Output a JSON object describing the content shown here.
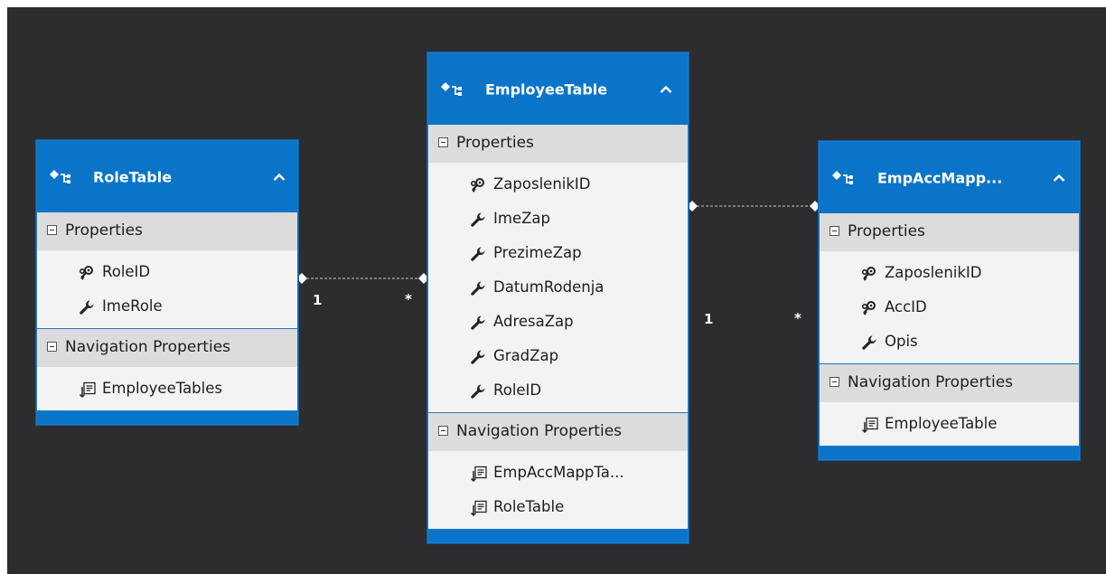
{
  "diagram": {
    "entities": [
      {
        "id": "role",
        "title": "RoleTable",
        "sections": [
          {
            "label": "Properties",
            "kind": "properties",
            "items": [
              {
                "label": "RoleID",
                "icon": "key-icon"
              },
              {
                "label": "ImeRole",
                "icon": "wrench-icon"
              }
            ]
          },
          {
            "label": "Navigation Properties",
            "kind": "navigation",
            "items": [
              {
                "label": "EmployeeTables",
                "icon": "navigation-property-icon"
              }
            ]
          }
        ]
      },
      {
        "id": "employee",
        "title": "EmployeeTable",
        "sections": [
          {
            "label": "Properties",
            "kind": "properties",
            "items": [
              {
                "label": "ZaposlenikID",
                "icon": "key-icon"
              },
              {
                "label": "ImeZap",
                "icon": "wrench-icon"
              },
              {
                "label": "PrezimeZap",
                "icon": "wrench-icon"
              },
              {
                "label": "DatumRodenja",
                "icon": "wrench-icon"
              },
              {
                "label": "AdresaZap",
                "icon": "wrench-icon"
              },
              {
                "label": "GradZap",
                "icon": "wrench-icon"
              },
              {
                "label": "RoleID",
                "icon": "wrench-icon"
              }
            ]
          },
          {
            "label": "Navigation Properties",
            "kind": "navigation",
            "items": [
              {
                "label": "EmpAccMappTa...",
                "icon": "navigation-property-icon"
              },
              {
                "label": "RoleTable",
                "icon": "navigation-property-icon"
              }
            ]
          }
        ]
      },
      {
        "id": "empacc",
        "title": "EmpAccMapp...",
        "sections": [
          {
            "label": "Properties",
            "kind": "properties",
            "items": [
              {
                "label": "ZaposlenikID",
                "icon": "key-icon"
              },
              {
                "label": "AccID",
                "icon": "key-icon"
              },
              {
                "label": "Opis",
                "icon": "wrench-icon"
              }
            ]
          },
          {
            "label": "Navigation Properties",
            "kind": "navigation",
            "items": [
              {
                "label": "EmployeeTable",
                "icon": "navigation-property-icon"
              }
            ]
          }
        ]
      }
    ],
    "associations": [
      {
        "from": "role",
        "to": "employee",
        "from_multiplicity": "1",
        "to_multiplicity": "*"
      },
      {
        "from": "employee",
        "to": "empacc",
        "from_multiplicity": "1",
        "to_multiplicity": "*"
      }
    ],
    "colors": {
      "canvas": "#2d2d30",
      "header": "#0a74c8",
      "section_header": "#dcdcdc",
      "body": "#f3f3f3",
      "connector": "#c8c8c8"
    }
  }
}
